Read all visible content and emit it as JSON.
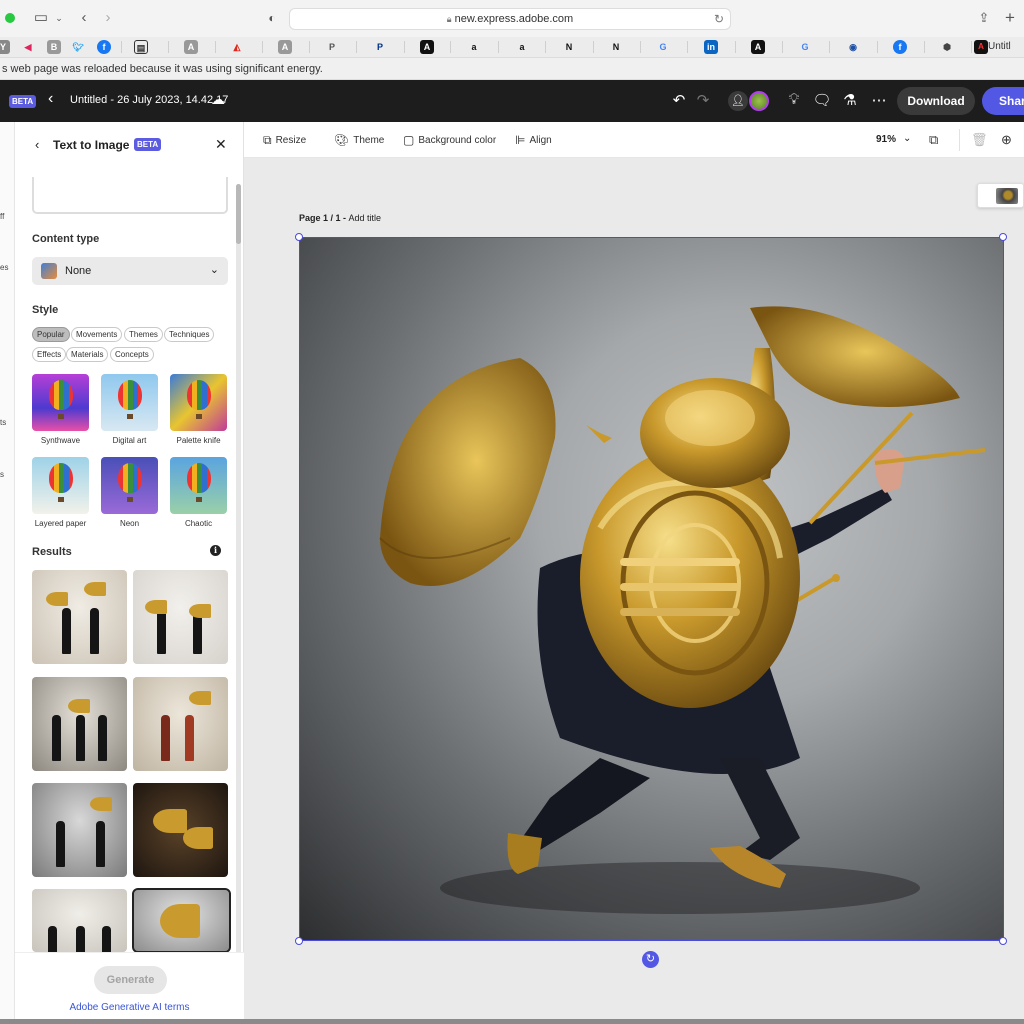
{
  "browser": {
    "url": "new.express.adobe.com",
    "last_tab_label": "Untitl",
    "energy_notice": "s web page was reloaded because it was using significant energy."
  },
  "appbar": {
    "beta_label": "BETA",
    "doc_title": "Untitled - 26 July 2023, 14.42.17",
    "download_label": "Download",
    "share_label": "Share"
  },
  "rail": {
    "fragments": [
      "ff",
      "es",
      "ts",
      "s"
    ]
  },
  "panel": {
    "title": "Text to Image",
    "beta_label": "BETA",
    "content_type_label": "Content type",
    "content_type_value": "None",
    "style_label": "Style",
    "chips": [
      {
        "label": "Popular",
        "active": true
      },
      {
        "label": "Movements"
      },
      {
        "label": "Themes"
      },
      {
        "label": "Techniques"
      },
      {
        "label": "Effects"
      },
      {
        "label": "Materials"
      },
      {
        "label": "Concepts"
      }
    ],
    "styles": [
      "Synthwave",
      "Digital art",
      "Palette knife",
      "Layered paper",
      "Neon",
      "Chaotic"
    ],
    "results_label": "Results",
    "generate_label": "Generate",
    "terms_label": "Adobe Generative AI terms"
  },
  "canvas": {
    "tools": {
      "resize": "Resize",
      "theme": "Theme",
      "background": "Background color",
      "align": "Align"
    },
    "zoom": "91%",
    "page_prefix": "Page 1 / 1 - ",
    "page_title_placeholder": "Add title"
  },
  "colors": {
    "accent": "#5258e4",
    "beta": "#5c5ce0",
    "appbar": "#1d1d1d",
    "brass": "#c99a2e"
  }
}
